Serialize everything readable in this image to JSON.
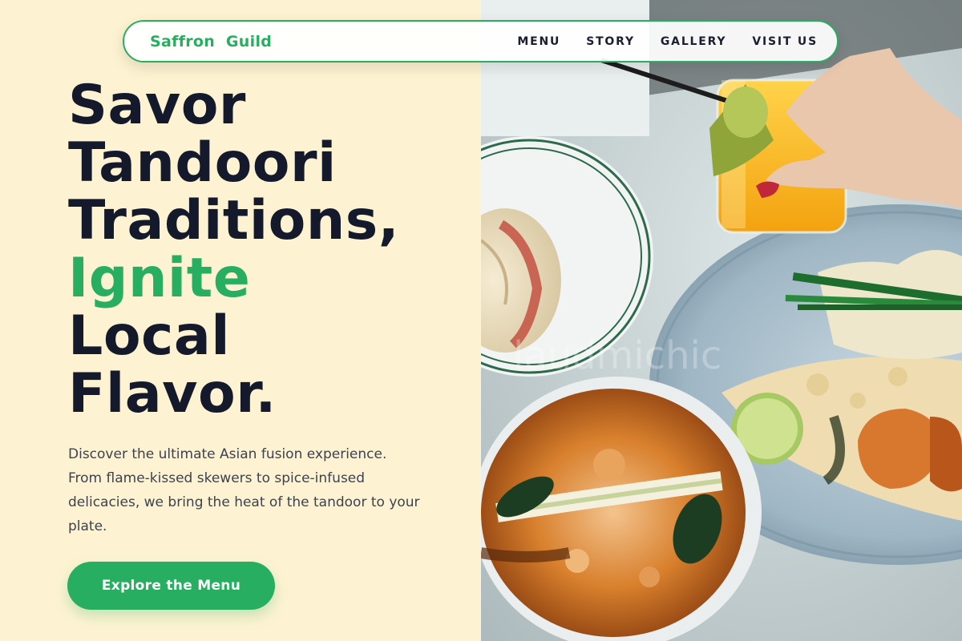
{
  "nav": {
    "brand": "Saffron  Guild",
    "links": [
      "MENU",
      "STORY",
      "GALLERY",
      "VISIT US"
    ]
  },
  "hero": {
    "headline_lines": [
      "Savor",
      "Tandoori",
      "Traditions,",
      "Ignite",
      "Local",
      "Flavor."
    ],
    "accent_line": "Ignite",
    "description": "Discover the ultimate Asian fusion experience. From flame-kissed skewers to spice-infused delicacies, we bring the heat of the tandoor to your plate.",
    "cta_label": "Explore the Menu"
  },
  "photo": {
    "subject": "food-photo-asian-dishes",
    "watermark": "laudmichic"
  },
  "colors": {
    "accent": "#27ae60",
    "background": "#fdf3d2",
    "heading": "#141a2b",
    "body_text": "#3b4252"
  }
}
